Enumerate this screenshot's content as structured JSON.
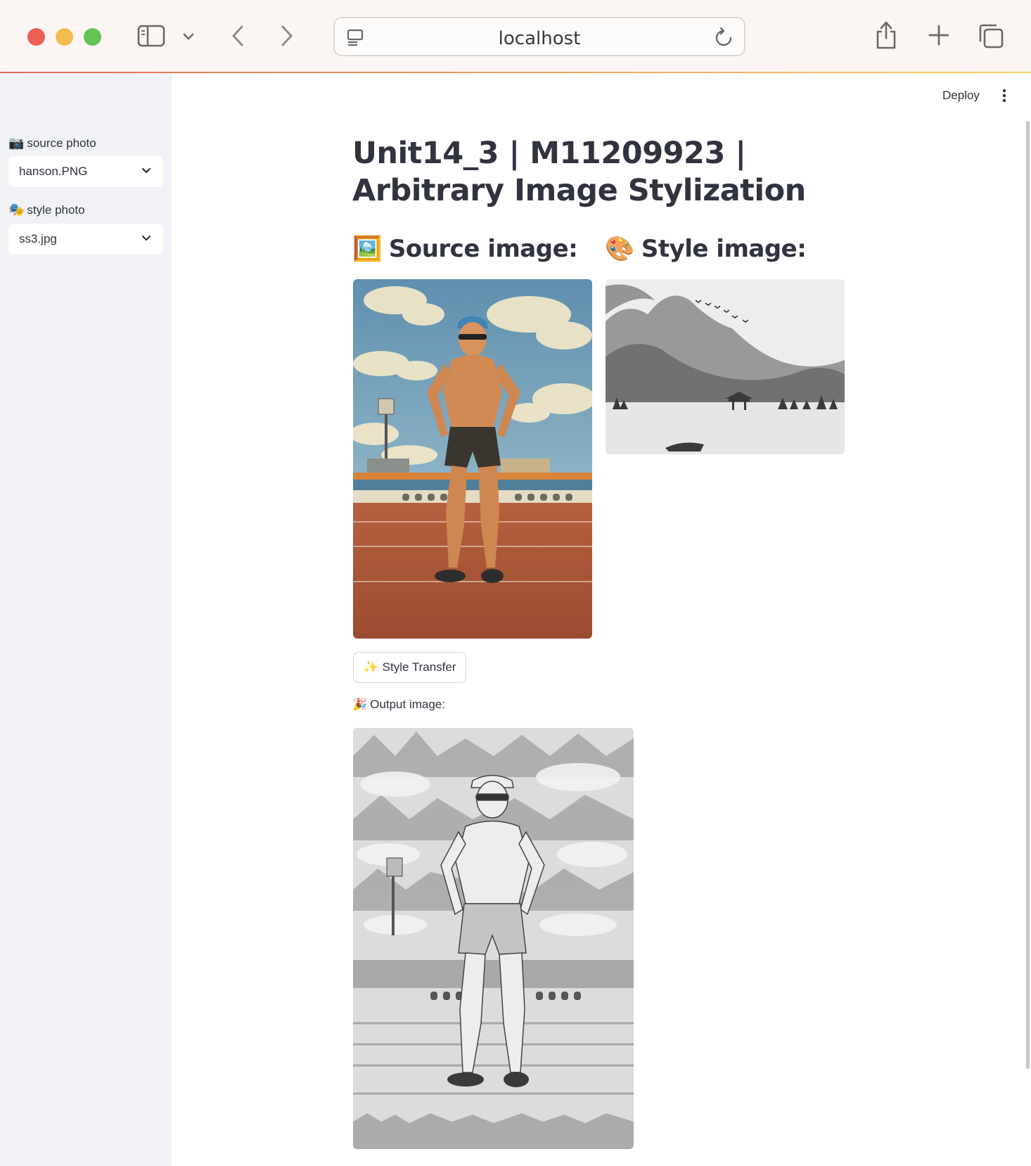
{
  "browser": {
    "url": "localhost",
    "icons": [
      "sidebar-icon",
      "chevron-down-icon",
      "back-icon",
      "forward-icon",
      "page-icon",
      "reload-icon",
      "share-icon",
      "plus-icon",
      "tabs-icon"
    ]
  },
  "header": {
    "deploy_label": "Deploy",
    "menu_icon": "kebab-menu-icon"
  },
  "sidebar": {
    "source": {
      "emoji": "📷",
      "label": "source photo",
      "selected": "hanson.PNG"
    },
    "style": {
      "emoji": "🎭",
      "label": "style photo",
      "selected": "ss3.jpg"
    }
  },
  "main": {
    "title": "Unit14_3 | M11209923 | Arbitrary Image Stylization",
    "source_heading": {
      "emoji": "🖼️",
      "text": "Source image:"
    },
    "style_heading": {
      "emoji": "🎨",
      "text": "Style image:"
    },
    "transfer_button": {
      "emoji": "✨",
      "label": "Style Transfer"
    },
    "output_label": {
      "emoji": "🎉",
      "text": "Output image:"
    }
  },
  "colors": {
    "sidebar_bg": "#f0f2f6",
    "text": "#31333f",
    "chrome_bg": "#fbf6f3"
  }
}
